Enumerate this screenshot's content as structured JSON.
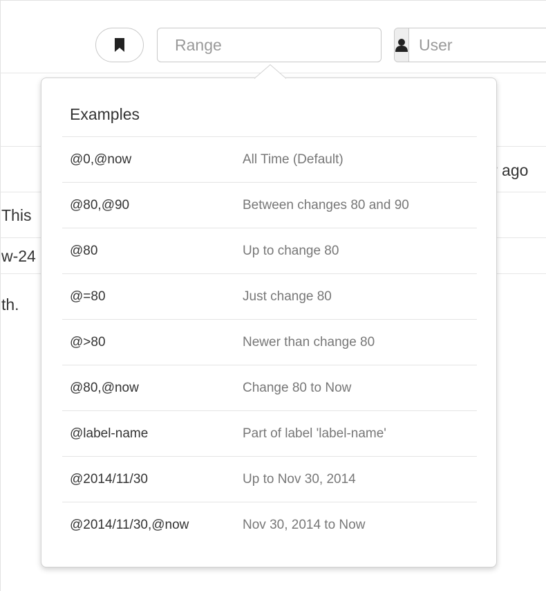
{
  "toolbar": {
    "range_placeholder": "Range",
    "user_placeholder": "User"
  },
  "background": {
    "line1": "r ago",
    "line2": "This",
    "line3": "w-24",
    "line4": "th."
  },
  "examples": {
    "heading": "Examples",
    "rows": [
      {
        "code": "@0,@now",
        "desc": "All Time (Default)"
      },
      {
        "code": "@80,@90",
        "desc": "Between changes 80 and 90"
      },
      {
        "code": "@80",
        "desc": "Up to change 80"
      },
      {
        "code": "@=80",
        "desc": "Just change 80"
      },
      {
        "code": "@>80",
        "desc": "Newer than change 80"
      },
      {
        "code": "@80,@now",
        "desc": "Change 80 to Now"
      },
      {
        "code": "@label-name",
        "desc": "Part of label 'label-name'"
      },
      {
        "code": "@2014/11/30",
        "desc": "Up to Nov 30, 2014"
      },
      {
        "code": "@2014/11/30,@now",
        "desc": "Nov 30, 2014 to Now"
      }
    ]
  }
}
